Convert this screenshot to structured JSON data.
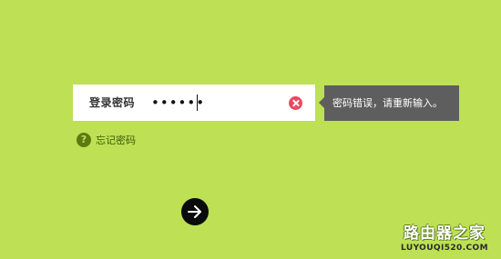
{
  "login": {
    "label": "登录密码",
    "password_value": "••••••"
  },
  "error": {
    "message": "密码错误，请重新输入。"
  },
  "forgot": {
    "label": "忘记密码",
    "icon_glyph": "?"
  },
  "watermark": {
    "title": "路由器之家",
    "url": "LUYOUQI520.COM"
  },
  "colors": {
    "background": "#bde055",
    "tooltip": "#5e5e5e",
    "clear_button": "#e84a5f",
    "help_icon": "#5c7a12",
    "submit_button": "#0b0b0b"
  },
  "icons": {
    "clear": "close-circle-icon",
    "help": "question-circle-icon",
    "submit": "arrow-right-icon"
  }
}
